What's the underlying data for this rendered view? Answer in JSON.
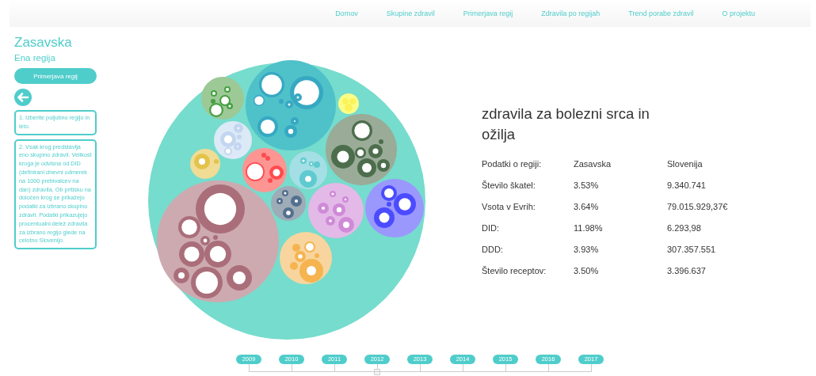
{
  "nav": [
    {
      "label": "Domov"
    },
    {
      "label": "Skupine zdravil"
    },
    {
      "label": "Primerjava regij"
    },
    {
      "label": "Zdravila po regijah"
    },
    {
      "label": "Trend porabe zdravil"
    },
    {
      "label": "O projektu"
    }
  ],
  "region": {
    "title": "Zasavska",
    "subtitle": "Ena regija",
    "compare_button": "Primerjava regij"
  },
  "instructions": [
    "1. Izberite poljubno regijo in leto.",
    "2. Vsak krog predstavlja eno skupino zdravil. Velikost kroga je odvisna od DID (definirani dnevni odmerek na 1000 prebivalcev na dan) zdravila. Ob pritisku na določen krog se prikažejo podatki za izbrano skupino zdravil. Podatki prikazujejo procentualni delež zdravila za izbrano regijo glede na celotno Slovenijo."
  ],
  "details": {
    "title": "zdravila za bolezni srca in ožilja",
    "header": [
      "Podatki o regiji:",
      "Zasavska",
      "Slovenija"
    ],
    "rows": [
      [
        "Število škatel:",
        "3.53%",
        "9.340.741"
      ],
      [
        "Vsota v Evrih:",
        "3.64%",
        "79.015.929,37€"
      ],
      [
        "DID:",
        "11.98%",
        "6.293,98"
      ],
      [
        "DDD:",
        "3.93%",
        "307.357.551"
      ],
      [
        "Število receptov:",
        "3.50%",
        "3.396.637"
      ]
    ]
  },
  "years": [
    {
      "label": "2009",
      "selected": false
    },
    {
      "label": "2010",
      "selected": false
    },
    {
      "label": "2011",
      "selected": false
    },
    {
      "label": "2012",
      "selected": true
    },
    {
      "label": "2013",
      "selected": false
    },
    {
      "label": "2014",
      "selected": false
    },
    {
      "label": "2015",
      "selected": false
    },
    {
      "label": "2016",
      "selected": false
    },
    {
      "label": "2017",
      "selected": false
    }
  ]
}
